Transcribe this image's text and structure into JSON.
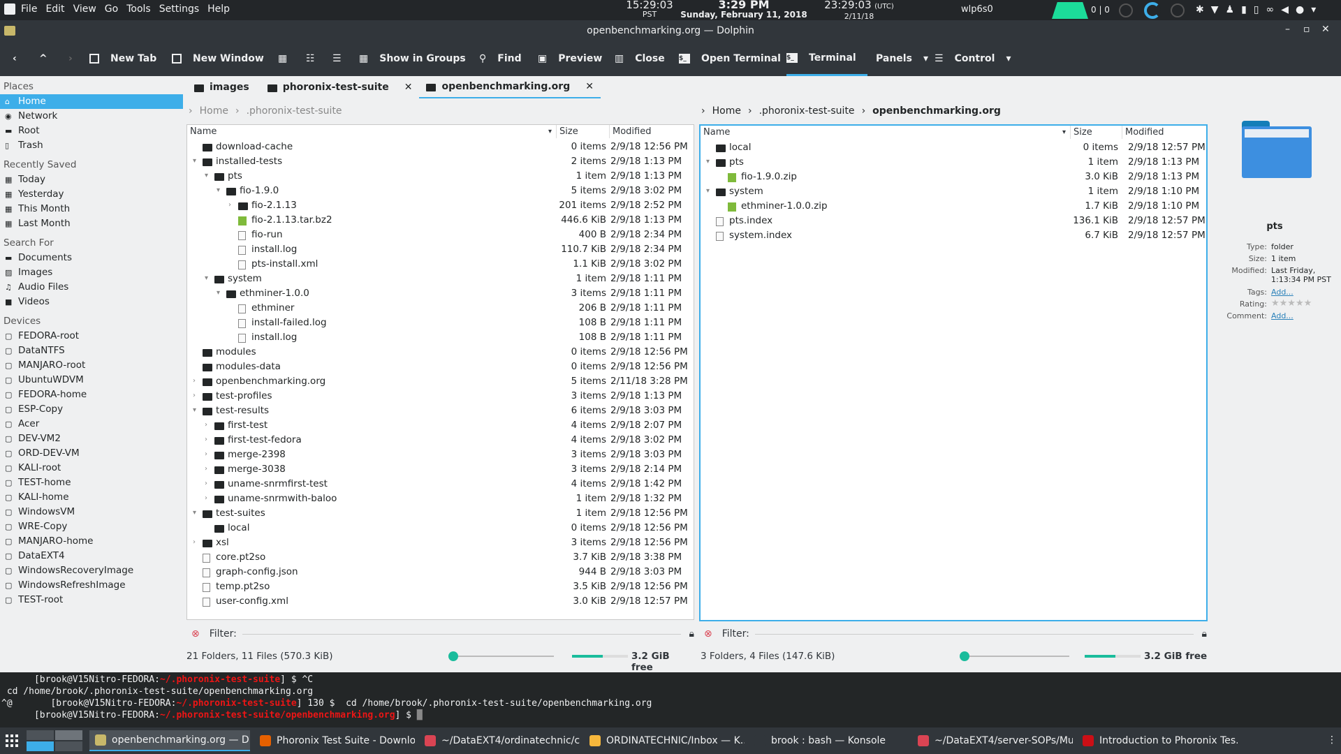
{
  "topbar": {
    "menus": [
      "File",
      "Edit",
      "View",
      "Go",
      "Tools",
      "Settings",
      "Help"
    ],
    "clock1_time": "15:29:03",
    "clock1_tz": "PST",
    "clock2_time": "3:29 PM",
    "clock2_date": "Sunday, February 11, 2018",
    "clock3_time": "23:29:03",
    "clock3_tz": "(UTC)",
    "clock3_date": "2/11/18",
    "network": "wlp6s0",
    "netstat": "0 | 0"
  },
  "window": {
    "title": "openbenchmarking.org — Dolphin"
  },
  "toolbar": {
    "new_tab": "New Tab",
    "new_window": "New Window",
    "show_groups": "Show in Groups",
    "find": "Find",
    "preview": "Preview",
    "close": "Close",
    "open_terminal": "Open Terminal",
    "terminal": "Terminal",
    "panels": "Panels",
    "control": "Control"
  },
  "places": {
    "heading": "Places",
    "items": [
      "Home",
      "Network",
      "Root",
      "Trash"
    ],
    "recent_heading": "Recently Saved",
    "recent": [
      "Today",
      "Yesterday",
      "This Month",
      "Last Month"
    ],
    "search_heading": "Search For",
    "search": [
      "Documents",
      "Images",
      "Audio Files",
      "Videos"
    ],
    "devices_heading": "Devices",
    "devices": [
      "FEDORA-root",
      "DataNTFS",
      "MANJARO-root",
      "UbuntuWDVM",
      "FEDORA-home",
      "ESP-Copy",
      "Acer",
      "DEV-VM2",
      "ORD-DEV-VM",
      "KALI-root",
      "TEST-home",
      "KALI-home",
      "WindowsVM",
      "WRE-Copy",
      "MANJARO-home",
      "DataEXT4",
      "WindowsRecoveryImage",
      "WindowsRefreshImage",
      "TEST-root"
    ]
  },
  "tabs": [
    {
      "label": "images"
    },
    {
      "label": "phoronix-test-suite"
    },
    {
      "label": "openbenchmarking.org"
    }
  ],
  "left": {
    "bread": [
      "Home",
      ".phoronix-test-suite"
    ],
    "cols": {
      "name": "Name",
      "size": "Size",
      "modified": "Modified"
    },
    "rows": [
      {
        "n": "download-cache",
        "s": "0 items",
        "m": "2/9/18 12:56 PM",
        "d": 0,
        "t": "folder",
        "e": ""
      },
      {
        "n": "installed-tests",
        "s": "2 items",
        "m": "2/9/18 1:13 PM",
        "d": 0,
        "t": "folder",
        "e": "open"
      },
      {
        "n": "pts",
        "s": "1 item",
        "m": "2/9/18 1:13 PM",
        "d": 1,
        "t": "folder",
        "e": "open"
      },
      {
        "n": "fio-1.9.0",
        "s": "5 items",
        "m": "2/9/18 3:02 PM",
        "d": 2,
        "t": "folder",
        "e": "open"
      },
      {
        "n": "fio-2.1.13",
        "s": "201 items",
        "m": "2/9/18 2:52 PM",
        "d": 3,
        "t": "folder",
        "e": "closed"
      },
      {
        "n": "fio-2.1.13.tar.bz2",
        "s": "446.6 KiB",
        "m": "2/9/18 1:13 PM",
        "d": 3,
        "t": "zip",
        "e": ""
      },
      {
        "n": "fio-run",
        "s": "400 B",
        "m": "2/9/18 2:34 PM",
        "d": 3,
        "t": "file",
        "e": ""
      },
      {
        "n": "install.log",
        "s": "110.7 KiB",
        "m": "2/9/18 2:34 PM",
        "d": 3,
        "t": "file",
        "e": ""
      },
      {
        "n": "pts-install.xml",
        "s": "1.1 KiB",
        "m": "2/9/18 3:02 PM",
        "d": 3,
        "t": "file",
        "e": ""
      },
      {
        "n": "system",
        "s": "1 item",
        "m": "2/9/18 1:11 PM",
        "d": 1,
        "t": "folder",
        "e": "open"
      },
      {
        "n": "ethminer-1.0.0",
        "s": "3 items",
        "m": "2/9/18 1:11 PM",
        "d": 2,
        "t": "folder",
        "e": "open"
      },
      {
        "n": "ethminer",
        "s": "206 B",
        "m": "2/9/18 1:11 PM",
        "d": 3,
        "t": "file",
        "e": ""
      },
      {
        "n": "install-failed.log",
        "s": "108 B",
        "m": "2/9/18 1:11 PM",
        "d": 3,
        "t": "file",
        "e": ""
      },
      {
        "n": "install.log",
        "s": "108 B",
        "m": "2/9/18 1:11 PM",
        "d": 3,
        "t": "file",
        "e": ""
      },
      {
        "n": "modules",
        "s": "0 items",
        "m": "2/9/18 12:56 PM",
        "d": 0,
        "t": "folder",
        "e": ""
      },
      {
        "n": "modules-data",
        "s": "0 items",
        "m": "2/9/18 12:56 PM",
        "d": 0,
        "t": "folder",
        "e": ""
      },
      {
        "n": "openbenchmarking.org",
        "s": "5 items",
        "m": "2/11/18 3:28 PM",
        "d": 0,
        "t": "folder",
        "e": "closed"
      },
      {
        "n": "test-profiles",
        "s": "3 items",
        "m": "2/9/18 1:13 PM",
        "d": 0,
        "t": "folder",
        "e": "closed"
      },
      {
        "n": "test-results",
        "s": "6 items",
        "m": "2/9/18 3:03 PM",
        "d": 0,
        "t": "folder",
        "e": "open"
      },
      {
        "n": "first-test",
        "s": "4 items",
        "m": "2/9/18 2:07 PM",
        "d": 1,
        "t": "folder",
        "e": "closed"
      },
      {
        "n": "first-test-fedora",
        "s": "4 items",
        "m": "2/9/18 3:02 PM",
        "d": 1,
        "t": "folder",
        "e": "closed"
      },
      {
        "n": "merge-2398",
        "s": "3 items",
        "m": "2/9/18 3:03 PM",
        "d": 1,
        "t": "folder",
        "e": "closed"
      },
      {
        "n": "merge-3038",
        "s": "3 items",
        "m": "2/9/18 2:14 PM",
        "d": 1,
        "t": "folder",
        "e": "closed"
      },
      {
        "n": "uname-snrmfirst-test",
        "s": "4 items",
        "m": "2/9/18 1:42 PM",
        "d": 1,
        "t": "folder",
        "e": "closed"
      },
      {
        "n": "uname-snrmwith-baloo",
        "s": "1 item",
        "m": "2/9/18 1:32 PM",
        "d": 1,
        "t": "folder",
        "e": "closed"
      },
      {
        "n": "test-suites",
        "s": "1 item",
        "m": "2/9/18 12:56 PM",
        "d": 0,
        "t": "folder",
        "e": "open"
      },
      {
        "n": "local",
        "s": "0 items",
        "m": "2/9/18 12:56 PM",
        "d": 1,
        "t": "folder",
        "e": ""
      },
      {
        "n": "xsl",
        "s": "3 items",
        "m": "2/9/18 12:56 PM",
        "d": 0,
        "t": "folder",
        "e": "closed"
      },
      {
        "n": "core.pt2so",
        "s": "3.7 KiB",
        "m": "2/9/18 3:38 PM",
        "d": 0,
        "t": "file",
        "e": ""
      },
      {
        "n": "graph-config.json",
        "s": "944 B",
        "m": "2/9/18 3:03 PM",
        "d": 0,
        "t": "file",
        "e": ""
      },
      {
        "n": "temp.pt2so",
        "s": "3.5 KiB",
        "m": "2/9/18 12:56 PM",
        "d": 0,
        "t": "file",
        "e": ""
      },
      {
        "n": "user-config.xml",
        "s": "3.0 KiB",
        "m": "2/9/18 12:57 PM",
        "d": 0,
        "t": "file",
        "e": ""
      }
    ],
    "filter": "Filter:",
    "status": "21 Folders, 11 Files (570.3 KiB)",
    "free": "3.2 GiB free",
    "free_fraction": 0.55
  },
  "right": {
    "bread": [
      "Home",
      ".phoronix-test-suite",
      "openbenchmarking.org"
    ],
    "cols": {
      "name": "Name",
      "size": "Size",
      "modified": "Modified"
    },
    "rows": [
      {
        "n": "local",
        "s": "0 items",
        "m": "2/9/18 12:57 PM",
        "d": 0,
        "t": "folder",
        "e": ""
      },
      {
        "n": "pts",
        "s": "1 item",
        "m": "2/9/18 1:13 PM",
        "d": 0,
        "t": "folder",
        "e": "open"
      },
      {
        "n": "fio-1.9.0.zip",
        "s": "3.0 KiB",
        "m": "2/9/18 1:13 PM",
        "d": 1,
        "t": "zip",
        "e": ""
      },
      {
        "n": "system",
        "s": "1 item",
        "m": "2/9/18 1:10 PM",
        "d": 0,
        "t": "folder",
        "e": "open"
      },
      {
        "n": "ethminer-1.0.0.zip",
        "s": "1.7 KiB",
        "m": "2/9/18 1:10 PM",
        "d": 1,
        "t": "zip",
        "e": ""
      },
      {
        "n": "pts.index",
        "s": "136.1 KiB",
        "m": "2/9/18 12:57 PM",
        "d": 0,
        "t": "file",
        "e": ""
      },
      {
        "n": "system.index",
        "s": "6.7 KiB",
        "m": "2/9/18 12:57 PM",
        "d": 0,
        "t": "file",
        "e": ""
      }
    ],
    "filter": "Filter:",
    "status": "3 Folders, 4 Files (147.6 KiB)",
    "free": "3.2 GiB free",
    "free_fraction": 0.55
  },
  "info": {
    "name": "pts",
    "type_k": "Type:",
    "type_v": "folder",
    "size_k": "Size:",
    "size_v": "1 item",
    "mod_k": "Modified:",
    "mod_v": "Last Friday, 1:13:34 PM PST",
    "tags_k": "Tags:",
    "tags_v": "Add...",
    "rating_k": "Rating:",
    "comment_k": "Comment:",
    "comment_v": "Add..."
  },
  "terminal": {
    "lines": [
      {
        "prompt": "[brook@V15Nitro-FEDORA:",
        "path": "~/.phoronix-test-suite",
        "rest": "] $ ^C"
      },
      {
        "prompt": "",
        "path": "",
        "rest": " cd /home/brook/.phoronix-test-suite/openbenchmarking.org"
      },
      {
        "prompt": "^@       [brook@V15Nitro-FEDORA:",
        "path": "~/.phoronix-test-suite",
        "rest": "] 130 $  cd /home/brook/.phoronix-test-suite/openbenchmarking.org"
      },
      {
        "prompt": "[brook@V15Nitro-FEDORA:",
        "path": "~/.phoronix-test-suite/openbenchmarking.org",
        "rest": "] $ "
      }
    ]
  },
  "taskbar": {
    "tasks": [
      "openbenchmarking.org — D...",
      "Phoronix Test Suite - Downlo...",
      "~/DataEXT4/ordinatechnic/c...",
      "ORDINATECHNIC/Inbox — K...",
      "brook : bash — Konsole",
      "~/DataEXT4/server-SOPs/Mu...",
      "Introduction to Phoronix Tes..."
    ]
  },
  "colors": {
    "accent": "#3daee9",
    "dark": "#31363b",
    "zip": "#7fba3b",
    "path": "#ed1515"
  }
}
